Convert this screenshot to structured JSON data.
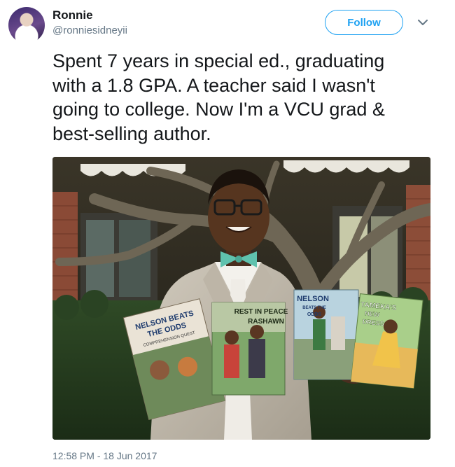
{
  "author": {
    "name": "Ronnie",
    "handle": "@ronniesidneyii"
  },
  "follow_label": "Follow",
  "tweet_text": "Spent 7 years in special ed., graduating\nwith a 1.8 GPA. A teacher said I wasn't\ngoing to college. Now I'm a VCU grad &\nbest-selling author.",
  "books": [
    {
      "title_line1": "NELSON BEATS",
      "title_line2": "THE ODDS",
      "subtitle": "COMPREHENSION QUEST"
    },
    {
      "title_line1": "REST IN PEACE",
      "title_line2": "RASHAWN"
    },
    {
      "title_line1": "NELSON",
      "title_line2": "BEATS THE",
      "title_line3": "ODDS"
    },
    {
      "title_line1": "TAMEKA'S",
      "title_line2": "NEW",
      "title_line3": "DRESS"
    }
  ],
  "timestamp": "12:58 PM - 18 Jun 2017",
  "icons": {
    "more": "chevron-down-icon"
  },
  "colors": {
    "accent": "#1da1f2",
    "text": "#14171a",
    "secondary": "#657786"
  }
}
